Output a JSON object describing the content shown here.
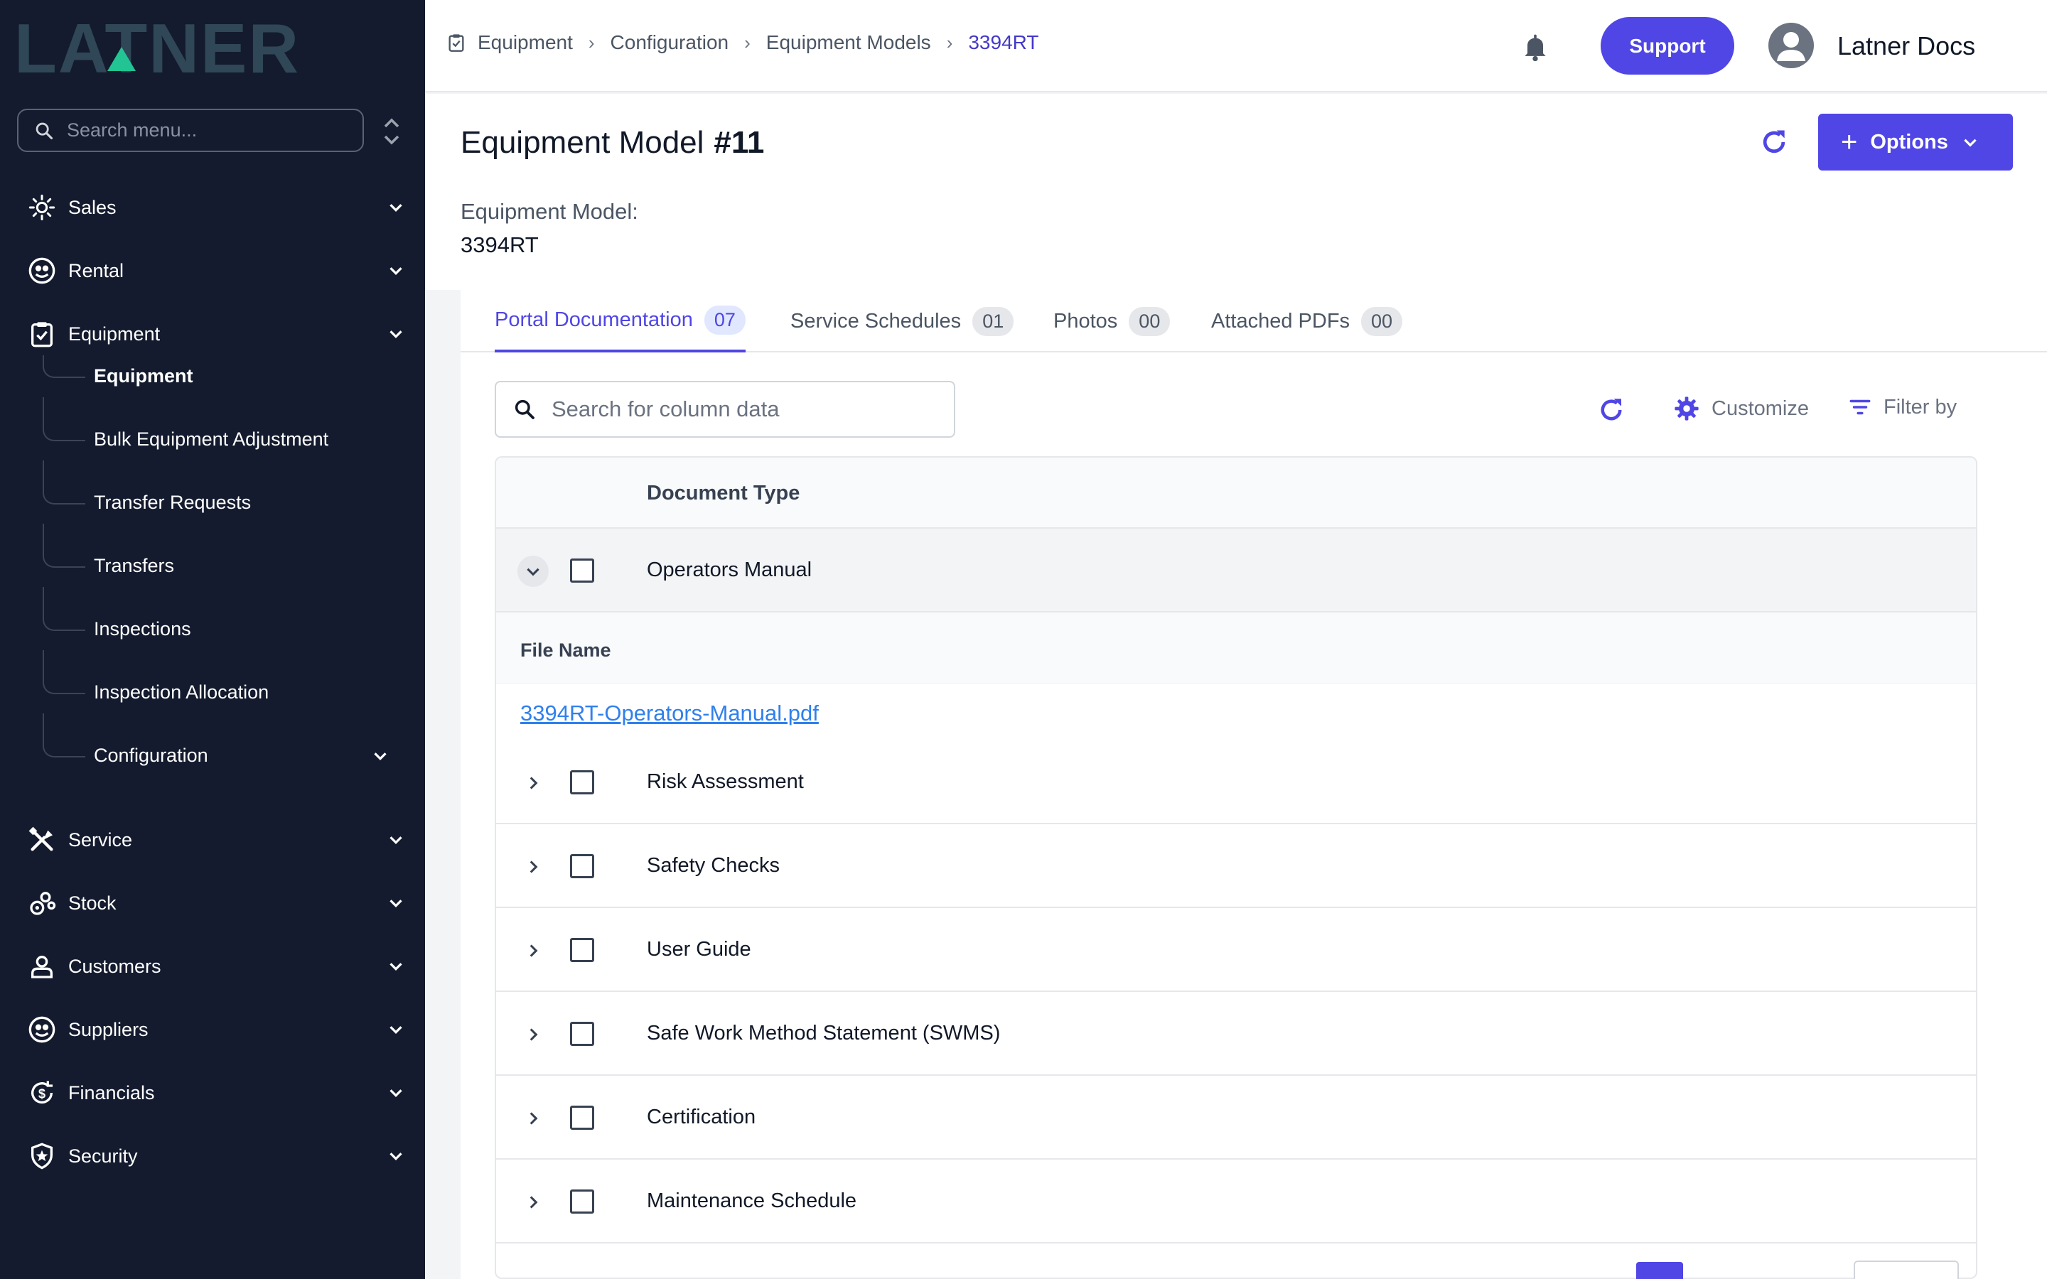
{
  "brand": {
    "logo_text": "LATNER"
  },
  "sidebar": {
    "search_placeholder": "Search menu...",
    "items": [
      {
        "label": "Sales"
      },
      {
        "label": "Rental"
      },
      {
        "label": "Equipment"
      },
      {
        "label": "Service"
      },
      {
        "label": "Stock"
      },
      {
        "label": "Customers"
      },
      {
        "label": "Suppliers"
      },
      {
        "label": "Financials"
      },
      {
        "label": "Security"
      }
    ],
    "equipment_sub": [
      {
        "label": "Equipment"
      },
      {
        "label": "Bulk Equipment Adjustment"
      },
      {
        "label": "Transfer Requests"
      },
      {
        "label": "Transfers"
      },
      {
        "label": "Inspections"
      },
      {
        "label": "Inspection Allocation"
      },
      {
        "label": "Configuration"
      }
    ]
  },
  "topbar": {
    "breadcrumb": [
      "Equipment",
      "Configuration",
      "Equipment Models",
      "3394RT"
    ],
    "support_label": "Support",
    "user_name": "Latner Docs"
  },
  "header": {
    "title": "Equipment Model",
    "record_number": "#11",
    "field_label": "Equipment Model:",
    "field_value": "3394RT",
    "options_label": "Options"
  },
  "tabs": [
    {
      "label": "Portal Documentation",
      "count": "07",
      "active": true
    },
    {
      "label": "Service Schedules",
      "count": "01"
    },
    {
      "label": "Photos",
      "count": "00"
    },
    {
      "label": "Attached PDFs",
      "count": "00"
    }
  ],
  "toolbar": {
    "search_placeholder": "Search for column data",
    "customize_label": "Customize",
    "filter_label": "Filter by"
  },
  "grid": {
    "column_header": "Document Type",
    "rows": [
      {
        "type": "Operators Manual",
        "expanded": true
      },
      {
        "type": "Risk Assessment"
      },
      {
        "type": "Safety Checks"
      },
      {
        "type": "User Guide"
      },
      {
        "type": "Safe Work Method Statement (SWMS)"
      },
      {
        "type": "Certification"
      },
      {
        "type": "Maintenance Schedule"
      }
    ],
    "detail": {
      "column_header": "File Name",
      "file": "3394RT-Operators-Manual.pdf"
    }
  },
  "colors": {
    "sidebar_bg": "#141b2e",
    "logo": "#2f4756",
    "logo_accent": "#22c493",
    "accent": "#4f46e5",
    "link": "#2f80ed"
  }
}
